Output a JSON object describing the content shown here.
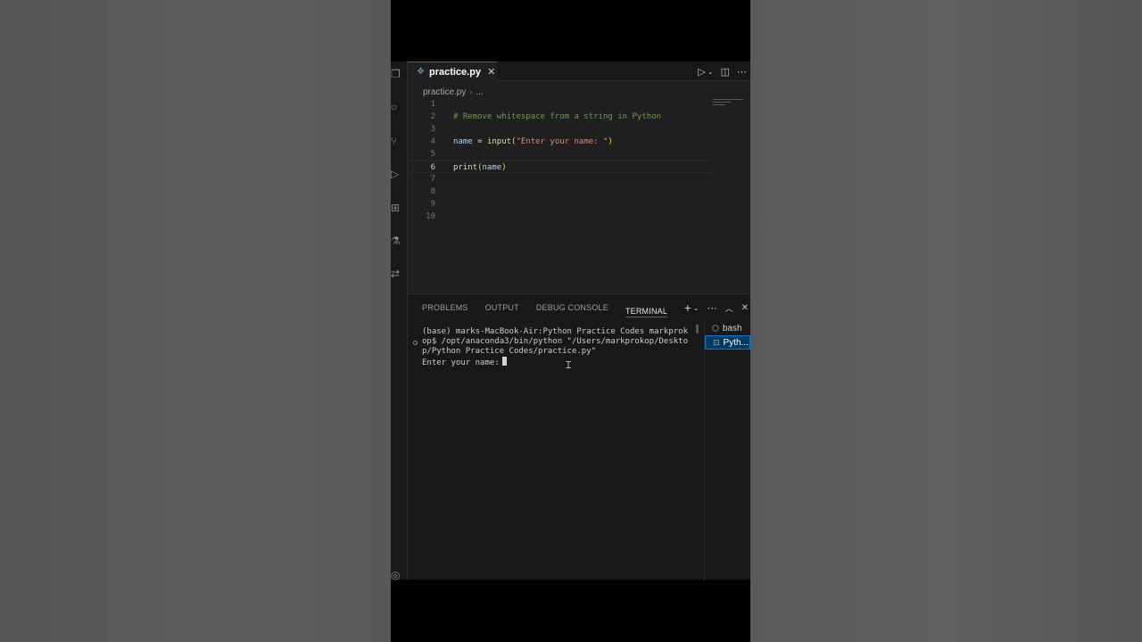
{
  "editor": {
    "tab_label": "practice.py",
    "tab_close": "✕",
    "breadcrumb": {
      "file": "practice.py",
      "sep": "›",
      "more": "..."
    },
    "lines": [
      {
        "num": "1",
        "parts": []
      },
      {
        "num": "2",
        "parts": [
          {
            "cls": "c-comment",
            "text": "# Remove whitespace from a string in Python"
          }
        ]
      },
      {
        "num": "3",
        "parts": []
      },
      {
        "num": "4",
        "parts": [
          {
            "cls": "c-var",
            "text": "name"
          },
          {
            "cls": "c-op",
            "text": " = "
          },
          {
            "cls": "c-fn",
            "text": "input"
          },
          {
            "cls": "c-paren",
            "text": "("
          },
          {
            "cls": "c-str",
            "text": "\"Enter your name: \""
          },
          {
            "cls": "c-paren",
            "text": ")"
          }
        ]
      },
      {
        "num": "5",
        "parts": []
      },
      {
        "num": "6",
        "current": true,
        "parts": [
          {
            "cls": "c-fn",
            "text": "print"
          },
          {
            "cls": "c-paren",
            "text": "("
          },
          {
            "cls": "c-var",
            "text": "name"
          },
          {
            "cls": "c-paren",
            "text": ")"
          }
        ]
      },
      {
        "num": "7",
        "parts": []
      },
      {
        "num": "8",
        "parts": []
      },
      {
        "num": "9",
        "parts": []
      },
      {
        "num": "10",
        "parts": []
      }
    ]
  },
  "panel": {
    "tabs": [
      "PROBLEMS",
      "OUTPUT",
      "DEBUG CONSOLE",
      "TERMINAL"
    ],
    "active_tab": "TERMINAL",
    "terminal_lines": [
      "(base) marks-MacBook-Air:Python Practice Codes markprok",
      "op$ /opt/anaconda3/bin/python \"/Users/markprokop/Deskto",
      "p/Python Practice Codes/practice.py\""
    ],
    "prompt": "Enter your name:",
    "terminals": [
      {
        "label": "bash",
        "icon": "terminal-bash-icon"
      },
      {
        "label": "Pyth...",
        "icon": "terminal-python-icon",
        "selected": true
      }
    ]
  },
  "colors": {
    "accent": "#0078d4",
    "editor_bg": "#1f1f1f",
    "panel_bg": "#181818"
  }
}
